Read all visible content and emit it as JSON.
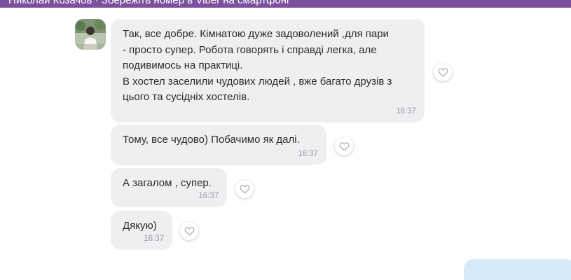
{
  "banner": {
    "text": "Николай Козачов · Збережіть номер в Viber на смартфоні",
    "color": "#7b519d"
  },
  "chat": {
    "contact_avatar": "contact-avatar-photo",
    "messages": [
      {
        "text": "Так, все добре. Кімнатою дуже задоволений ,для пари\n- просто супер. Робота говорять і справді легка, але\nподивимось на практиці.\nВ хостел заселили чудових людей , вже багато друзів з\nцього та сусідніх хостелів.",
        "time": "16:37"
      },
      {
        "text": "Тому, все чудово) Побачимо як далі.",
        "time": "16:37"
      },
      {
        "text": "А загалом , супер.",
        "time": "16:37"
      },
      {
        "text": "Дякую)",
        "time": "16:37"
      }
    ],
    "like_icon": "heart-outline-icon",
    "bubble_color": "#efeff1",
    "outgoing_bubble_color": "#d8e9f7"
  }
}
